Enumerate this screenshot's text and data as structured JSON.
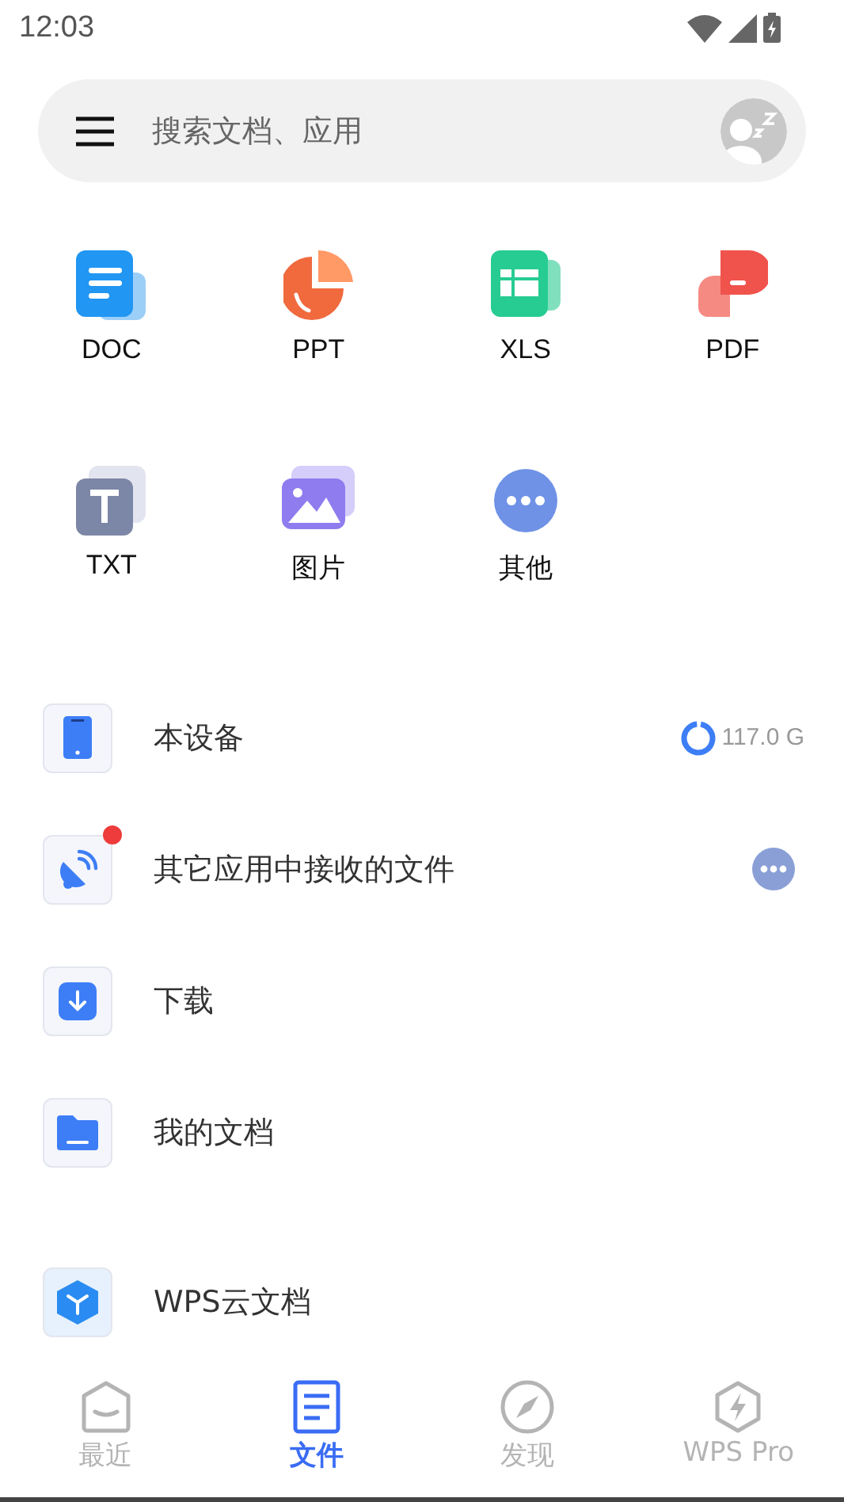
{
  "status_bar": {
    "time": "12:03"
  },
  "search": {
    "placeholder": "搜索文档、应用"
  },
  "categories": [
    {
      "kind": "doc",
      "label": "DOC"
    },
    {
      "kind": "ppt",
      "label": "PPT"
    },
    {
      "kind": "xls",
      "label": "XLS"
    },
    {
      "kind": "pdf",
      "label": "PDF"
    },
    {
      "kind": "txt",
      "label": "TXT"
    },
    {
      "kind": "image",
      "label": "图片"
    },
    {
      "kind": "other",
      "label": "其他"
    }
  ],
  "locations": [
    {
      "kind": "device",
      "label": "本设备",
      "storage": {
        "reading": "117.0 G"
      }
    },
    {
      "kind": "received",
      "label": "其它应用中接收的文件",
      "badge": true,
      "more": true
    },
    {
      "kind": "download",
      "label": "下载"
    },
    {
      "kind": "folder",
      "label": "我的文档"
    }
  ],
  "cloud": [
    {
      "kind": "cloud",
      "label": "WPS云文档"
    }
  ],
  "nav": [
    {
      "kind": "recent",
      "label": "最近",
      "selected": false
    },
    {
      "kind": "files",
      "label": "文件",
      "selected": true
    },
    {
      "kind": "discover",
      "label": "发现",
      "selected": false
    },
    {
      "kind": "pro",
      "label": "WPS Pro",
      "selected": false
    }
  ]
}
